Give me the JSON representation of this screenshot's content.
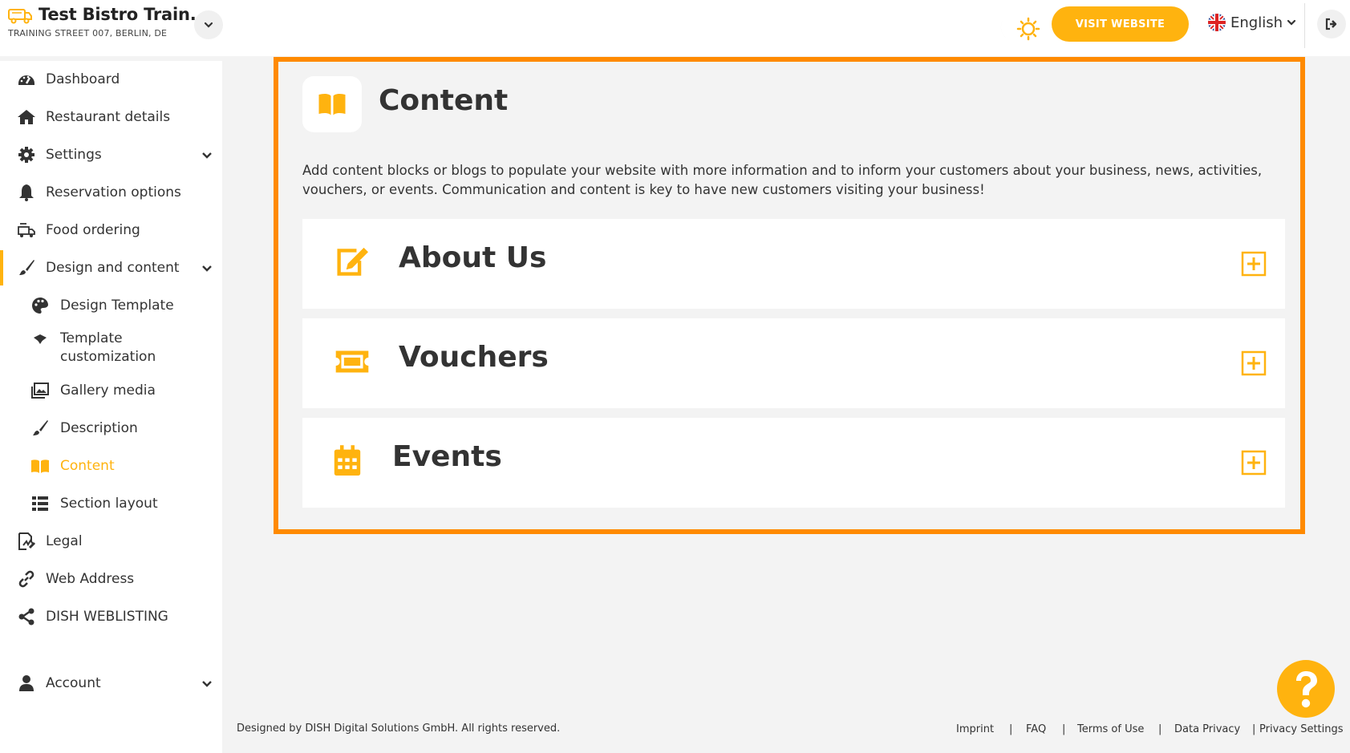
{
  "header": {
    "restaurant_name": "Test Bistro Train...",
    "restaurant_address": "TRAINING STREET 007, BERLIN, DE",
    "visit_button": "VISIT WEBSITE",
    "language": "English"
  },
  "sidebar": {
    "items": [
      {
        "label": "Dashboard",
        "icon": "dashboard-icon"
      },
      {
        "label": "Restaurant details",
        "icon": "home-icon"
      },
      {
        "label": "Settings",
        "icon": "gear-icon"
      },
      {
        "label": "Reservation options",
        "icon": "bell-icon"
      },
      {
        "label": "Food ordering",
        "icon": "food-ordering-icon"
      },
      {
        "label": "Design and content",
        "icon": "paintbrush-icon"
      },
      {
        "label": "Design Template",
        "icon": "palette-icon"
      },
      {
        "label": "Template customization",
        "icon": "swatches-icon"
      },
      {
        "label": "Gallery media",
        "icon": "images-icon"
      },
      {
        "label": "Description",
        "icon": "brush-icon"
      },
      {
        "label": "Content",
        "icon": "book-open-icon"
      },
      {
        "label": "Section layout",
        "icon": "list-icon"
      },
      {
        "label": "Legal",
        "icon": "signature-icon"
      },
      {
        "label": "Web Address",
        "icon": "link-icon"
      },
      {
        "label": "DISH WEBLISTING",
        "icon": "share-icon"
      },
      {
        "label": "Account",
        "icon": "user-icon"
      }
    ]
  },
  "main": {
    "title": "Content",
    "description": "Add content blocks or blogs to populate your website with more information and to inform your customers about your business, news, activities, vouchers, or events. Communication and content is key to have new customers visiting your business!",
    "blocks": [
      {
        "title": "About Us",
        "icon": "edit-icon"
      },
      {
        "title": "Vouchers",
        "icon": "ticket-icon"
      },
      {
        "title": "Events",
        "icon": "calendar-icon"
      }
    ]
  },
  "footer": {
    "copyright": "Designed by DISH Digital Solutions GmbH. All rights reserved.",
    "links": [
      "Imprint",
      "FAQ",
      "Terms of Use",
      "Data Privacy",
      "Privacy Settings"
    ],
    "separator": "|"
  },
  "colors": {
    "accent": "#ffb30f",
    "highlight_border": "#ff8a00"
  }
}
